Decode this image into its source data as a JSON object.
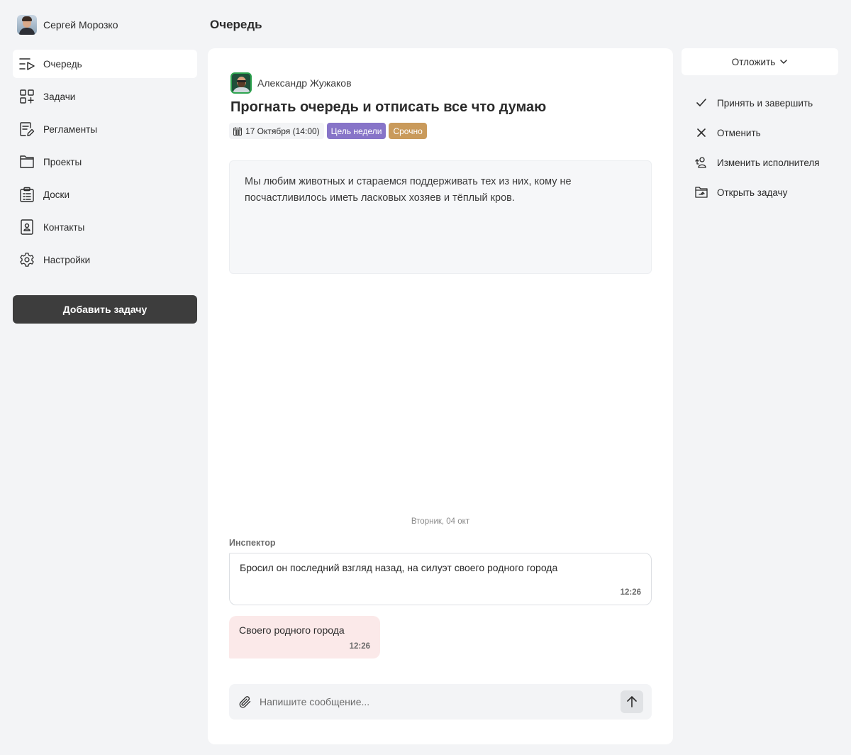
{
  "user": {
    "name": "Сергей Морозко"
  },
  "nav": {
    "items": [
      {
        "label": "Очередь",
        "icon": "queue-icon"
      },
      {
        "label": "Задачи",
        "icon": "tasks-grid-icon"
      },
      {
        "label": "Регламенты",
        "icon": "document-edit-icon"
      },
      {
        "label": "Проекты",
        "icon": "folder-icon"
      },
      {
        "label": "Доски",
        "icon": "clipboard-icon"
      },
      {
        "label": "Контакты",
        "icon": "contact-card-icon"
      },
      {
        "label": "Настройки",
        "icon": "gear-icon"
      }
    ],
    "add_task_label": "Добавить задачу"
  },
  "header": {
    "title": "Очередь"
  },
  "task": {
    "author": "Александр Жужаков",
    "title": "Прогнать очередь и отписать все что думаю",
    "date": "17 Октября (14:00)",
    "tags": [
      {
        "label": "Цель недели",
        "color": "#8774c8"
      },
      {
        "label": "Срочно",
        "color": "#c99a5b"
      }
    ],
    "description": "Мы любим животных и стараемся поддерживать тех из них, кому не посчастливилось иметь ласковых хозяев и тёплый кров."
  },
  "chat": {
    "day_separator": "Вторник, 04 окт",
    "incoming": {
      "author": "Инспектор",
      "text": "Бросил он последний взгляд назад, на силуэт своего родного города",
      "time": "12:26"
    },
    "outgoing": {
      "text": "Своего родного города",
      "time": "12:26"
    },
    "composer_placeholder": "Напишите сообщение..."
  },
  "actions": {
    "postpone_label": "Отложить",
    "items": [
      {
        "label": "Принять и завершить",
        "icon": "check-icon"
      },
      {
        "label": "Отменить",
        "icon": "close-icon"
      },
      {
        "label": "Изменить исполнителя",
        "icon": "user-switch-icon"
      },
      {
        "label": "Открыть задачу",
        "icon": "folder-open-icon"
      }
    ]
  }
}
